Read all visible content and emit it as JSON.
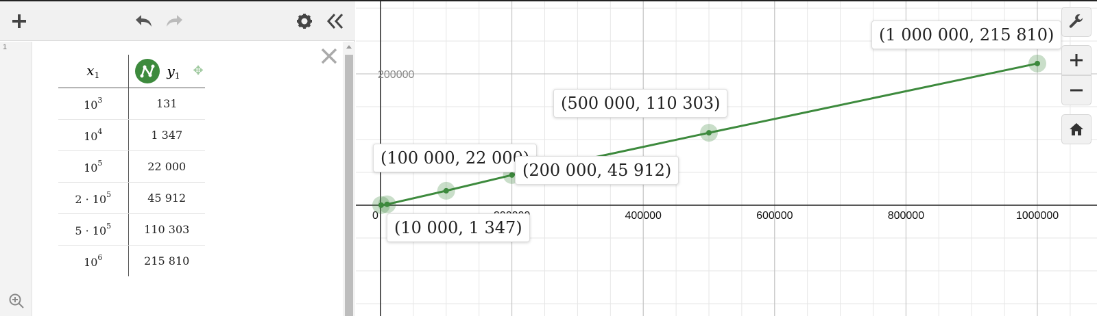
{
  "left_panel": {
    "row_number": "1",
    "table": {
      "col_x_label": "x",
      "col_x_sub": "1",
      "col_y_label": "y",
      "col_y_sub": "1",
      "rows": [
        {
          "x_base": "10",
          "x_exp": "3",
          "x_prefix": "",
          "y": "131"
        },
        {
          "x_base": "10",
          "x_exp": "4",
          "x_prefix": "",
          "y": "1 347"
        },
        {
          "x_base": "10",
          "x_exp": "5",
          "x_prefix": "",
          "y": "22 000"
        },
        {
          "x_base": "10",
          "x_exp": "5",
          "x_prefix": "2 · ",
          "y": "45 912"
        },
        {
          "x_base": "10",
          "x_exp": "5",
          "x_prefix": "5 · ",
          "y": "110 303"
        },
        {
          "x_base": "10",
          "x_exp": "6",
          "x_prefix": "",
          "y": "215 810"
        }
      ]
    },
    "toolbar_icons": [
      "add-icon",
      "undo-icon",
      "redo-icon",
      "gear-icon",
      "collapse-panel-icon"
    ],
    "series_color": "#3d8a3d"
  },
  "chart_data": {
    "type": "line",
    "x": [
      1000,
      10000,
      100000,
      200000,
      500000,
      1000000
    ],
    "y": [
      131,
      1347,
      22000,
      45912,
      110303,
      215810
    ],
    "x_ticks": [
      "0",
      "200000",
      "400000",
      "600000",
      "800000",
      "1000000"
    ],
    "y_ticks": [
      "200000"
    ],
    "grid": true,
    "color": "#3d8a3d",
    "labels": [
      "(10 000, 1 347)",
      "(100 000, 22 000)",
      "(200 000, 45 912)",
      "(500 000, 110 303)",
      "(1 000 000, 215 810)"
    ]
  },
  "graph_tools": [
    "wrench-icon",
    "zoom-in-icon",
    "zoom-out-icon",
    "home-icon"
  ]
}
